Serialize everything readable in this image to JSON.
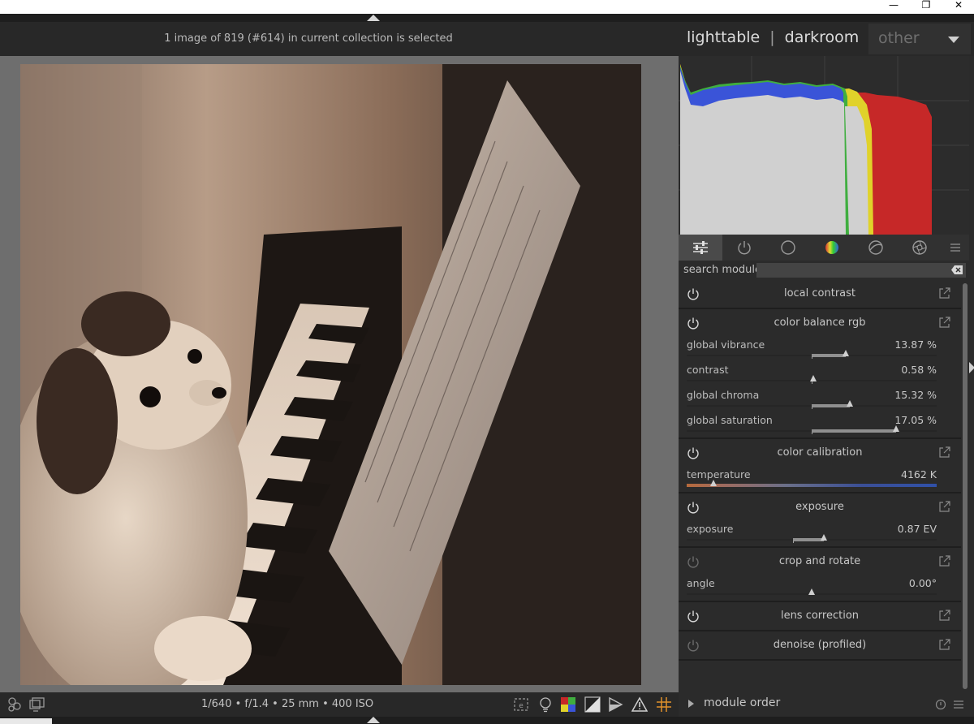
{
  "window": {
    "minimize_glyph": "—",
    "restore_glyph": "❐",
    "close_glyph": "✕"
  },
  "header": {
    "selection_info": "1 image of 819 (#614) in current collection is selected",
    "views": {
      "lighttable": "lighttable",
      "darkroom": "darkroom",
      "other": "other",
      "separator": "|"
    }
  },
  "module_tabs": [
    {
      "name": "quick-access",
      "icon": "sliders-icon",
      "active": true
    },
    {
      "name": "active-modules",
      "icon": "power-icon",
      "active": false
    },
    {
      "name": "base",
      "icon": "circle-icon",
      "active": false
    },
    {
      "name": "color",
      "icon": "color-wheel-icon",
      "active": false
    },
    {
      "name": "correct",
      "icon": "circle-arrows-icon",
      "active": false
    },
    {
      "name": "effect",
      "icon": "aperture-icon",
      "active": false
    },
    {
      "name": "presets",
      "icon": "hamburger-icon",
      "active": false
    }
  ],
  "search": {
    "label": "search module",
    "value": "",
    "placeholder": ""
  },
  "modules": {
    "local_contrast": {
      "title": "local contrast",
      "enabled": true
    },
    "color_balance_rgb": {
      "title": "color balance rgb",
      "enabled": true,
      "sliders": {
        "global_vibrance": {
          "label": "global vibrance",
          "value": "13.87 %"
        },
        "contrast": {
          "label": "contrast",
          "value": "0.58 %"
        },
        "global_chroma": {
          "label": "global chroma",
          "value": "15.32 %"
        },
        "global_saturation": {
          "label": "global saturation",
          "value": "17.05 %"
        }
      }
    },
    "color_calibration": {
      "title": "color calibration",
      "enabled": true,
      "sliders": {
        "temperature": {
          "label": "temperature",
          "value": "4162 K"
        }
      }
    },
    "exposure": {
      "title": "exposure",
      "enabled": true,
      "sliders": {
        "exposure": {
          "label": "exposure",
          "value": "0.87 EV"
        }
      }
    },
    "crop_and_rotate": {
      "title": "crop and rotate",
      "enabled": false,
      "sliders": {
        "angle": {
          "label": "angle",
          "value": "0.00°"
        }
      }
    },
    "lens_correction": {
      "title": "lens correction",
      "enabled": true
    },
    "denoise_profiled": {
      "title": "denoise (profiled)",
      "enabled": false
    }
  },
  "bottom": {
    "exif": "1/640 • f/1.4 • 25 mm • 400 ISO",
    "module_order": "module order"
  },
  "colors": {
    "accent_red": "#c62828",
    "accent_yellow": "#e0d22a",
    "accent_green": "#3fae3f",
    "accent_blue": "#3a54d8",
    "focus_peak_orange": "#e0902a"
  }
}
